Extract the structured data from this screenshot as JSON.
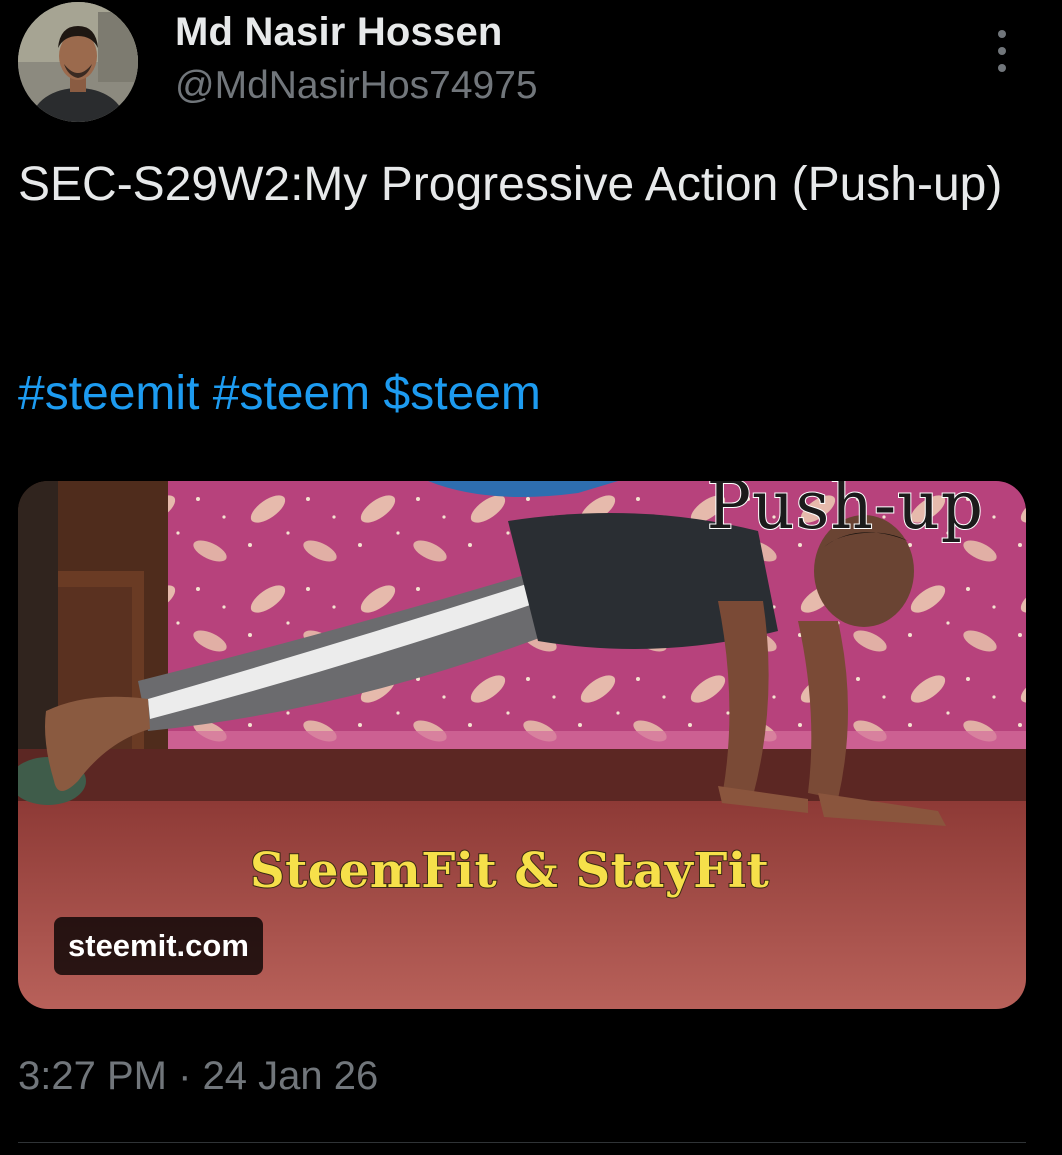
{
  "author": {
    "display_name": "Md Nasir Hossen",
    "handle": "@MdNasirHos74975",
    "avatar_icon": "user-avatar"
  },
  "post": {
    "text": "SEC-S29W2:My Progressive Action (Push-up)",
    "hashtags": [
      "#steemit",
      "#steem",
      "$steem"
    ],
    "timestamp": "3:27 PM · 24 Jan 26"
  },
  "card": {
    "overlay_title": "Push-up",
    "overlay_caption": "SteemFit & StayFit",
    "domain": "steemit.com"
  },
  "colors": {
    "background": "#000000",
    "text_primary": "#e7e9ea",
    "text_secondary": "#71767b",
    "link": "#1d9bf0",
    "divider": "#2f3336"
  },
  "icons": {
    "more": "more-vertical-icon"
  }
}
